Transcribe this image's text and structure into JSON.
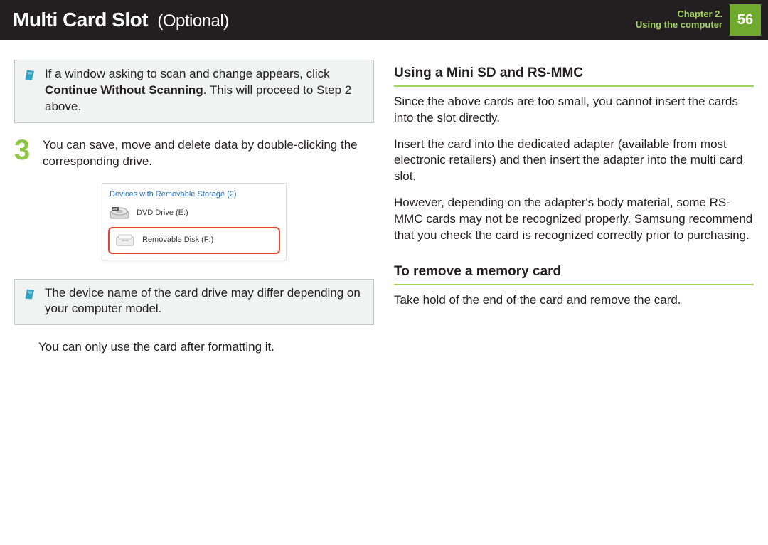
{
  "header": {
    "title_main": "Multi Card Slot",
    "title_sub": "Optional",
    "chapter_line1": "Chapter 2.",
    "chapter_line2": "Using the computer",
    "page_number": "56"
  },
  "left": {
    "note1_pre": "If a window asking to scan and change appears, click ",
    "note1_bold": "Continue Without Scanning",
    "note1_post": ". This will proceed to Step 2 above.",
    "step_number": "3",
    "step_text": "You can save, move and delete data by double-clicking the corresponding drive.",
    "illus": {
      "heading": "Devices with Removable Storage (2)",
      "row1": "DVD Drive (E:)",
      "row2": "Removable Disk (F:)"
    },
    "note2": "The device name of the card drive may differ depending on your computer model.",
    "after_note": "You can only use the card after formatting it."
  },
  "right": {
    "heading1": "Using a Mini SD and RS-MMC",
    "p1": "Since the above cards are too small, you cannot insert the cards into the slot directly.",
    "p2": "Insert the card into the dedicated adapter (available from most electronic retailers) and then insert the adapter into the multi card slot.",
    "p3": "However, depending on the adapter's body material, some RS-MMC cards may not be recognized properly. Samsung recommend that you check the card is recognized correctly prior to purchasing.",
    "heading2": "To remove a memory card",
    "p4": "Take hold of the end of the card and remove the card."
  }
}
